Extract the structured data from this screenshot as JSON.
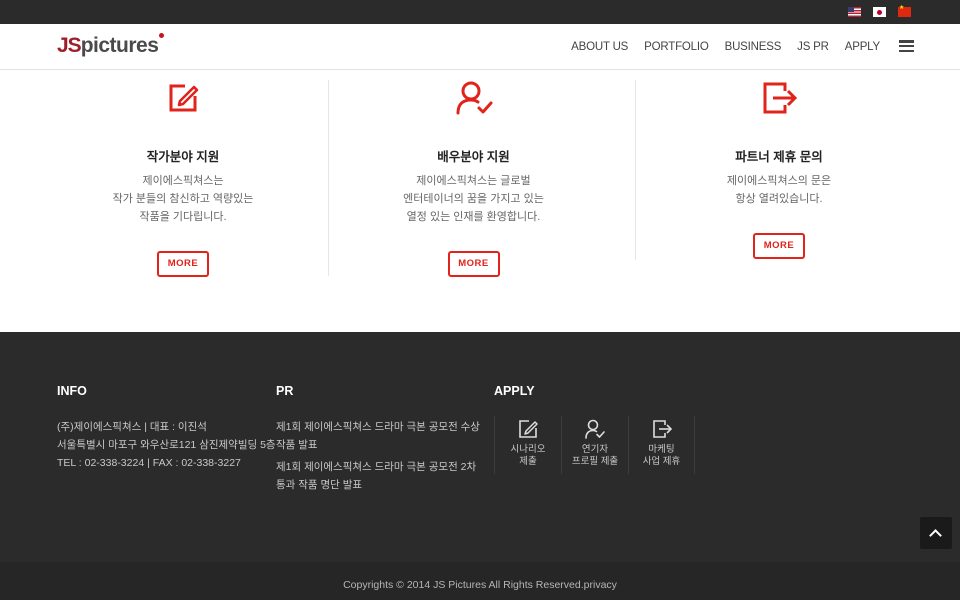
{
  "topbar": {
    "languages": [
      {
        "code": "en",
        "icon": "flag-us-icon"
      },
      {
        "code": "ja",
        "icon": "flag-jp-icon"
      },
      {
        "code": "zh",
        "icon": "flag-cn-icon"
      }
    ]
  },
  "header": {
    "logo_js": "JS",
    "logo_rest": "pictures",
    "nav": [
      "ABOUT US",
      "PORTFOLIO",
      "BUSINESS",
      "JS PR",
      "APPLY"
    ],
    "menu_icon": "hamburger-menu-icon"
  },
  "features": [
    {
      "icon": "edit-icon",
      "title": "작가분야 지원",
      "desc": [
        "제이에스픽쳐스는",
        "작가 분들의 참신하고 역량있는",
        "작품을 기다립니다."
      ],
      "button": "MORE"
    },
    {
      "icon": "user-check-icon",
      "title": "배우분야 지원",
      "desc": [
        "제이에스픽쳐스는 글로벌",
        "엔터테이너의 꿈을 가지고 있는",
        "열정 있는 인재를 환영합니다."
      ],
      "button": "MORE"
    },
    {
      "icon": "exit-icon",
      "title": "파트너 제휴 문의",
      "desc": [
        "제이에스픽쳐스의 문은",
        "항상 열려있습니다."
      ],
      "button": "MORE"
    }
  ],
  "footer": {
    "info": {
      "title": "INFO",
      "lines": [
        "(주)제이에스픽쳐스 | 대표 : 이진석",
        "서울특별시 마포구 와우산로121 삼진제약빌딩 5층",
        "TEL : 02-338-3224 | FAX : 02-338-3227"
      ]
    },
    "pr": {
      "title": "PR",
      "items": [
        "제1회 제이에스픽쳐스 드라마 극본 공모전 수상 작품 발표",
        "제1회 제이에스픽쳐스 드라마 극본 공모전 2차 통과 작품 명단 발표"
      ]
    },
    "apply": {
      "title": "APPLY",
      "items": [
        {
          "icon": "edit-icon",
          "label": [
            "시나리오",
            "제출"
          ]
        },
        {
          "icon": "user-check-icon",
          "label": [
            "연기자",
            "프로필 제출"
          ]
        },
        {
          "icon": "exit-icon",
          "label": [
            "마케팅",
            "사업 제휴"
          ]
        }
      ]
    },
    "copyright": "Copyrights © 2014 JS Pictures All Rights Reserved.privacy"
  },
  "colors": {
    "accent": "#e0231b",
    "logo_red": "#9e1f28",
    "footer_bg": "#2b2b2b"
  }
}
